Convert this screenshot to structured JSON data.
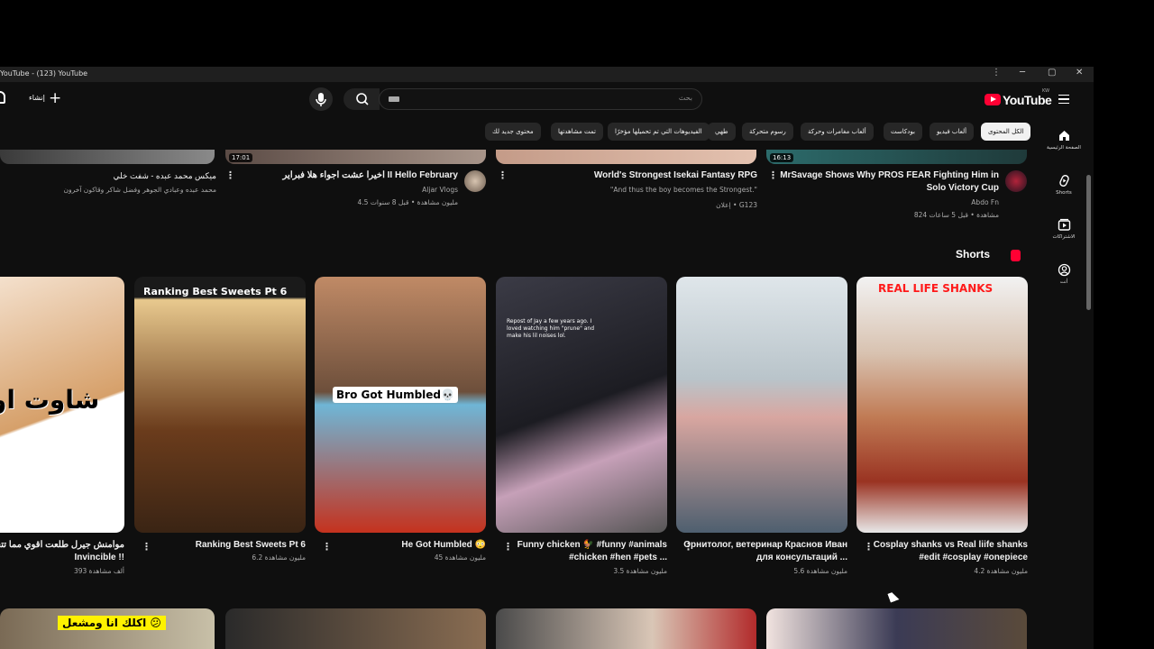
{
  "window": {
    "title": "YouTube - (123) YouTube",
    "controls": {
      "more": "⋮",
      "minimize": "─",
      "maximize": "▢",
      "close": "✕"
    }
  },
  "masthead": {
    "create_label": "إنشاء",
    "search_placeholder": "بحث",
    "logo_text": "YouTube",
    "country_code": "KW"
  },
  "chips": [
    "الكل المحتوى",
    "ألعاب فيديو",
    "بودكاست",
    "ألعاب مغامرات وحركة",
    "رسوم متحركة",
    "طهي",
    "الفيديوهات التي تم تحميلها مؤخرًا",
    "تمت مشاهدتها",
    "محتوى جديد لك"
  ],
  "guide": [
    {
      "label": "الصفحة الرئيسية",
      "icon": "home-icon"
    },
    {
      "label": "Shorts",
      "icon": "shorts-icon"
    },
    {
      "label": "الاشتراكات",
      "icon": "subscriptions-icon"
    },
    {
      "label": "أنت",
      "icon": "you-icon"
    }
  ],
  "videos": [
    {
      "title": "ميكس محمد عبده - شفت خلي",
      "sub1": "محمد عبده وعبادي الجوهر وفضل شاكر وقاكون آخرون",
      "sub2": "",
      "duration": ""
    },
    {
      "title": "اخيرا عشت اجواء هلا فبراير II Hello February",
      "sub1": "Aljar Vlogs",
      "sub2": "4.5 مليون مشاهدة • قبل 8 سنوات",
      "duration": "17:01"
    },
    {
      "title": "World's Strongest Isekai Fantasy RPG",
      "sub1": "\"And thus the boy becomes the Strongest.\"",
      "sub2": "إعلان • G123",
      "duration": ""
    },
    {
      "title": "MrSavage Shows Why PROS FEAR Fighting Him in Solo Victory Cup",
      "sub1": "Abdo Fn",
      "sub2": "824 مشاهدة • قبل 5 ساعات",
      "duration": "16:13"
    }
  ],
  "shorts_header": "Shorts",
  "shorts": [
    {
      "title": "موامنش جيرل طلعت اقوي مما تتخيل ‏Invincible !!",
      "views": "393 ألف مشاهدة",
      "overlay": "شاوت او"
    },
    {
      "title": "Ranking Best Sweets Pt 6",
      "views": "6.2 مليون مشاهدة",
      "overlay": "Ranking Best Sweets Pt 6"
    },
    {
      "title": "He Got Humbled 😳",
      "views": "45 مليون مشاهدة",
      "overlay": "Bro Got Humbled💀"
    },
    {
      "title": "Funny chicken 🐓 #funny #animals #chicken #hen #pets ...",
      "views": "3.5 مليون مشاهدة",
      "overlay": "Repost of Jay a few years ago. I loved watching him \"prune\" and make his lil noises lol."
    },
    {
      "title": "Орнитолог, ветеринар Краснов Иван для консультаций ...",
      "views": "5.6 مليون مشاهدة",
      "overlay": ""
    },
    {
      "title": "Cosplay shanks vs Real liife shanks #edit #cosplay #onepiece",
      "views": "4.2 مليون مشاهدة",
      "overlay": "REAL LIFE SHANKS"
    }
  ],
  "bottom_row_overlay": "اكلك انا ومشعل 😕",
  "colors": {
    "background": "#0f0f0f",
    "accent": "#ff0033",
    "chip": "#272727"
  }
}
